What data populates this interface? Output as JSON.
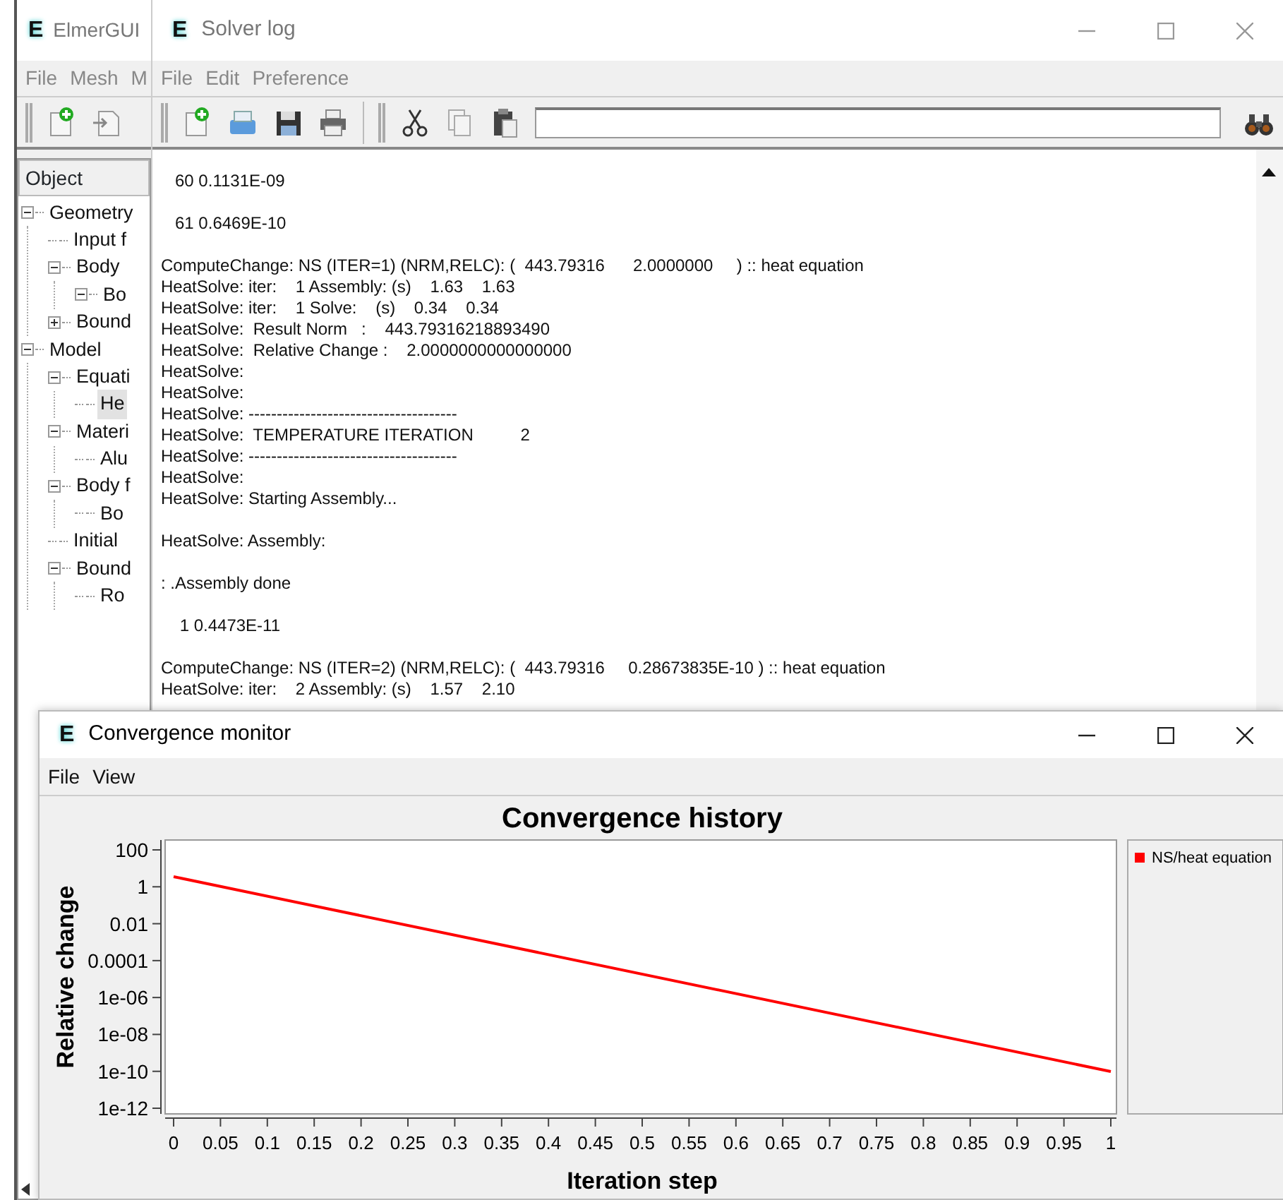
{
  "main_window": {
    "logo": "E",
    "title": "ElmerGUI",
    "active": false,
    "menu": [
      "File",
      "Mesh",
      "M"
    ],
    "tree_header": "Object",
    "tree": [
      {
        "label": "Geometry",
        "expanded": true,
        "selected": false,
        "children": [
          {
            "label": "Input f",
            "selected": false
          },
          {
            "label": "Body",
            "expanded": true,
            "selected": false,
            "children": [
              {
                "label": "Bo",
                "expanded": true,
                "selected": false
              }
            ]
          },
          {
            "label": "Bound",
            "expanded": false,
            "selected": false
          }
        ]
      },
      {
        "label": "Model",
        "expanded": true,
        "selected": false,
        "children": [
          {
            "label": "Equati",
            "expanded": true,
            "selected": false,
            "children": [
              {
                "label": "He",
                "selected": true
              }
            ]
          },
          {
            "label": "Materi",
            "expanded": true,
            "selected": false,
            "children": [
              {
                "label": "Alu",
                "selected": false
              }
            ]
          },
          {
            "label": "Body f",
            "expanded": true,
            "selected": false,
            "children": [
              {
                "label": "Bo",
                "selected": false
              }
            ]
          },
          {
            "label": "Initial",
            "selected": false
          },
          {
            "label": "Bound",
            "expanded": true,
            "selected": false,
            "children": [
              {
                "label": "Ro",
                "selected": false
              }
            ]
          }
        ]
      }
    ]
  },
  "solver_log": {
    "logo": "E",
    "title": "Solver log",
    "active": false,
    "menu": [
      "File",
      "Edit",
      "Preference"
    ],
    "lines": [
      {
        "kind": "blank"
      },
      {
        "kind": "text",
        "text": "   60 0.1131E-09"
      },
      {
        "kind": "blank"
      },
      {
        "kind": "text",
        "text": "   61 0.6469E-10"
      },
      {
        "kind": "blank"
      },
      {
        "kind": "text",
        "text": "ComputeChange: NS (ITER=1) (NRM,RELC): (  443.79316      2.0000000     ) :: heat equation"
      },
      {
        "kind": "text",
        "text": "HeatSolve: iter:    1 Assembly: (s)    1.63    1.63"
      },
      {
        "kind": "text",
        "text": "HeatSolve: iter:    1 Solve:    (s)    0.34    0.34"
      },
      {
        "kind": "text",
        "text": "HeatSolve:  Result Norm   :    443.79316218893490"
      },
      {
        "kind": "text",
        "text": "HeatSolve:  Relative Change :    2.0000000000000000"
      },
      {
        "kind": "text",
        "text": "HeatSolve:"
      },
      {
        "kind": "text",
        "text": "HeatSolve:"
      },
      {
        "kind": "text",
        "text": "HeatSolve: -------------------------------------"
      },
      {
        "kind": "text",
        "text": "HeatSolve:  TEMPERATURE ITERATION          2"
      },
      {
        "kind": "text",
        "text": "HeatSolve: -------------------------------------"
      },
      {
        "kind": "text",
        "text": "HeatSolve:"
      },
      {
        "kind": "text",
        "text": "HeatSolve: Starting Assembly..."
      },
      {
        "kind": "blank"
      },
      {
        "kind": "text",
        "text": "HeatSolve: Assembly:"
      },
      {
        "kind": "blank"
      },
      {
        "kind": "text",
        "text": ": .Assembly done"
      },
      {
        "kind": "blank"
      },
      {
        "kind": "text",
        "text": "    1 0.4473E-11"
      },
      {
        "kind": "blank"
      },
      {
        "kind": "text",
        "text": "ComputeChange: NS (ITER=2) (NRM,RELC): (  443.79316     0.28673835E-10 ) :: heat equation"
      },
      {
        "kind": "text",
        "text": "HeatSolve: iter:    2 Assembly: (s)    1.57    2.10"
      }
    ]
  },
  "monitor": {
    "logo": "E",
    "title": "Convergence monitor",
    "active": true,
    "menu": [
      "File",
      "View"
    ],
    "chart": {
      "title": "Convergence history",
      "xlabel": "Iteration step",
      "ylabel": "Relative change",
      "x_tick_labels": [
        "0",
        "0.05",
        "0.1",
        "0.15",
        "0.2",
        "0.25",
        "0.3",
        "0.35",
        "0.4",
        "0.45",
        "0.5",
        "0.55",
        "0.6",
        "0.65",
        "0.7",
        "0.75",
        "0.8",
        "0.85",
        "0.9",
        "0.95",
        "1"
      ],
      "y_tick_labels": [
        "100",
        "1",
        "0.01",
        "0.0001",
        "1e-06",
        "1e-08",
        "1e-10",
        "1e-12"
      ],
      "legend": [
        {
          "name": "NS/heat equation",
          "color": "#ff0000"
        }
      ]
    }
  }
}
